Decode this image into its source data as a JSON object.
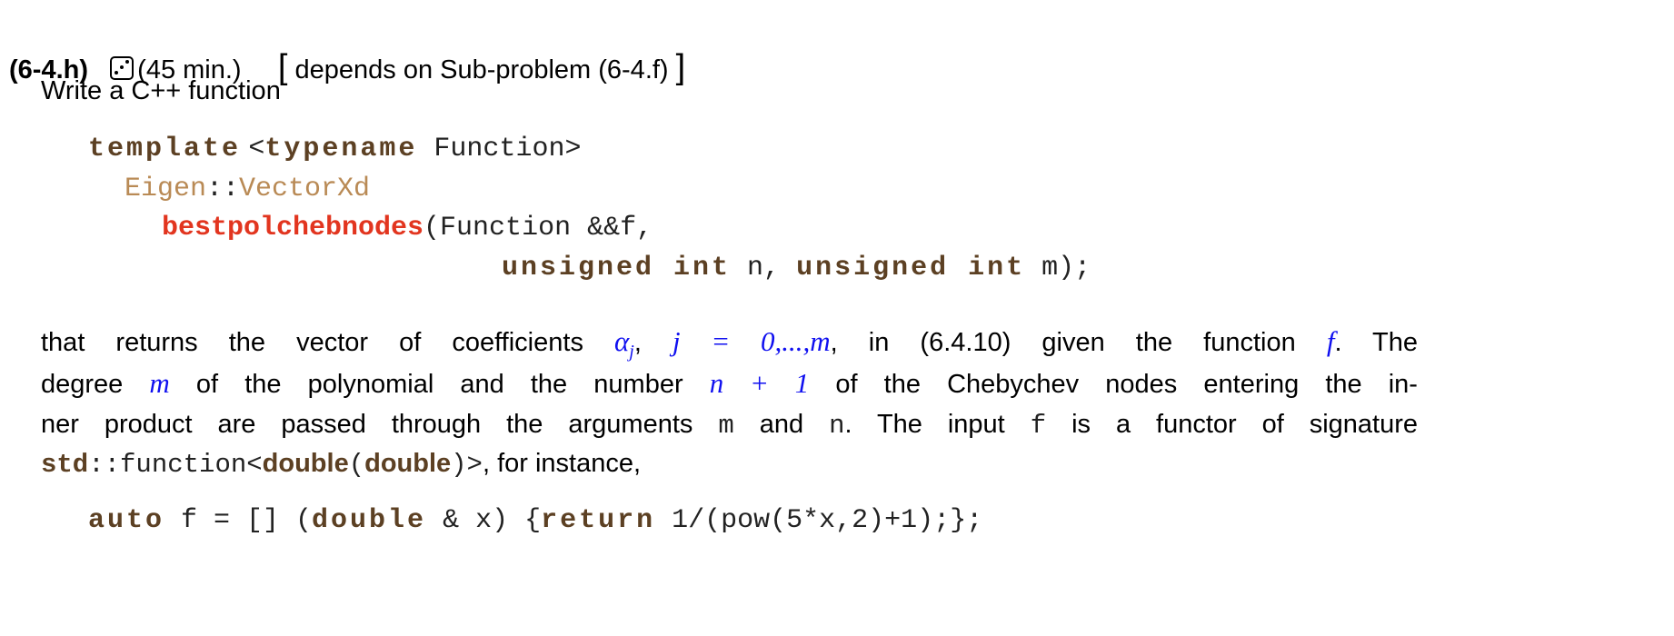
{
  "header": {
    "id": "(6-4.h)",
    "icon": "die-three-icon",
    "time": "(45 min.)",
    "bracket_open": "[",
    "depends": "depends on Sub-problem (6-4.f)",
    "bracket_close": "]"
  },
  "intro": "Write a C++ function",
  "code1": {
    "l1": {
      "kw": "template",
      "rest1": "<",
      "kw2": "typename",
      "rest2": " Function>"
    },
    "l2": {
      "ns": "Eigen",
      "sep": "::",
      "type": "VectorXd"
    },
    "l3": {
      "fn": "bestpolchebnodes",
      "rest": "(Function &&f,"
    },
    "l4": {
      "kw1": "unsigned int",
      "a": " n, ",
      "kw2": "unsigned int",
      "b": " m);"
    }
  },
  "para": {
    "l1": {
      "t1": "that returns the vector of coefficients",
      "m1": "α",
      "m1sub": "j",
      ",": ",",
      "m2": "j = 0,...,m",
      "t2": ", in (6.4.10) given the function",
      "m3": "f",
      "t3": ".  The"
    },
    "l2": {
      "t1": "degree",
      "m1": "m",
      "t2": "of the polynomial and the number",
      "m2": "n + 1",
      "t3": "of the Chebychev nodes entering the in-"
    },
    "l3": {
      "t1": "ner product are passed through the arguments",
      "c1": "m",
      "t2": "and",
      "c2": "n",
      "t3": ".  The input",
      "c3": "f",
      "t4": "is a functor of signature"
    },
    "l4": {
      "k1": "std",
      "s1": "::function<",
      "k2": "double",
      "s2": "(",
      "k3": "double",
      "s3": ")>",
      "t1": ", for instance,"
    }
  },
  "code2": {
    "kw1": "auto",
    "a": " f = [] (",
    "kw2": "double",
    "b": " & x) {",
    "kw3": "return",
    "c": " 1/(pow(5*x,2)+1);};"
  },
  "colors": {
    "keyword": "#5c4023",
    "type": "#b98a55",
    "function": "#e2351f",
    "math": "#1010f0"
  }
}
